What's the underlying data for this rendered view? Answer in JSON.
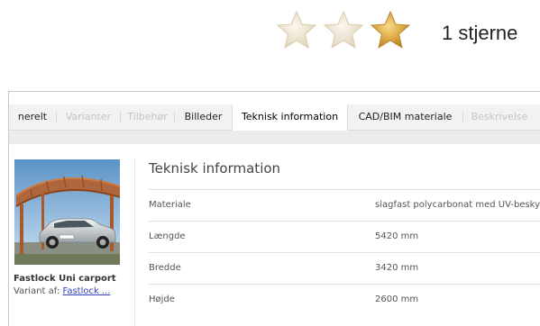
{
  "rating": {
    "label": "1 stjerne",
    "stars": [
      {
        "icon": "star-icon",
        "state": "empty"
      },
      {
        "icon": "star-icon",
        "state": "empty"
      },
      {
        "icon": "star-icon",
        "state": "filled"
      }
    ],
    "colors": {
      "filled": "#d9a63a",
      "empty": "#efe6d2"
    }
  },
  "tabs": [
    {
      "label": "nerelt",
      "state": "enabled"
    },
    {
      "label": "Varianter",
      "state": "disabled"
    },
    {
      "label": "Tilbehør",
      "state": "disabled"
    },
    {
      "label": "Billeder",
      "state": "enabled"
    },
    {
      "label": "Teknisk information",
      "state": "active"
    },
    {
      "label": "CAD/BIM materiale",
      "state": "enabled"
    },
    {
      "label": "Beskrivelse",
      "state": "disabled"
    }
  ],
  "product": {
    "name": "Fastlock Uni carport",
    "variant_prefix": "Variant af:",
    "variant_link": "Fastlock ..."
  },
  "tech": {
    "title": "Teknisk information",
    "rows": [
      {
        "key": "Materiale",
        "value": "slagfast polycarbonat med UV-besky"
      },
      {
        "key": "Længde",
        "value": "5420 mm"
      },
      {
        "key": "Bredde",
        "value": "3420 mm"
      },
      {
        "key": "Højde",
        "value": "2600 mm"
      }
    ]
  }
}
